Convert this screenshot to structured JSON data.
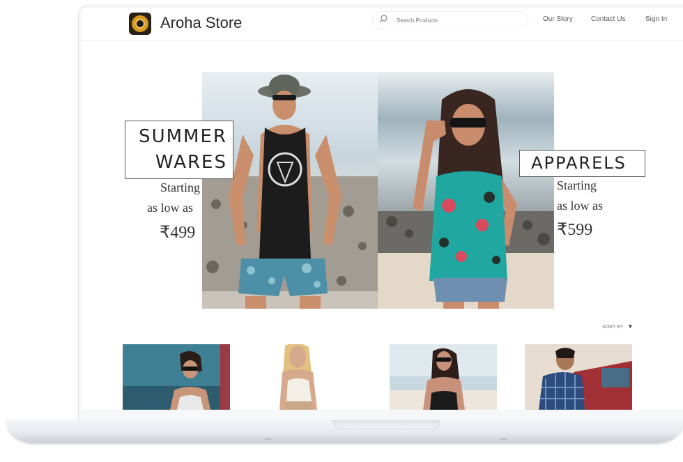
{
  "header": {
    "brand": "Aroha Store",
    "search_placeholder": "Search Products",
    "nav": [
      "Our Story",
      "Contact Us",
      "Sign In"
    ]
  },
  "promos": [
    {
      "title_line1": "SUMMER",
      "title_line2": "WARES",
      "subtitle_line1": "Starting",
      "subtitle_line2": "as low as",
      "price": "₹499"
    },
    {
      "title_line1": "APPARELS",
      "subtitle_line1": "Starting",
      "subtitle_line2": "as low as",
      "price": "₹599"
    }
  ],
  "sort": {
    "label": "SORT BY"
  },
  "products": [
    {
      "alt": "woman in sunglasses by a van"
    },
    {
      "alt": "woman in white crop top"
    },
    {
      "alt": "woman in sunglasses at the beach"
    },
    {
      "alt": "man in plaid shirt by a red car"
    }
  ],
  "colors": {
    "accent": "#222222",
    "text": "#2b2b2b"
  }
}
